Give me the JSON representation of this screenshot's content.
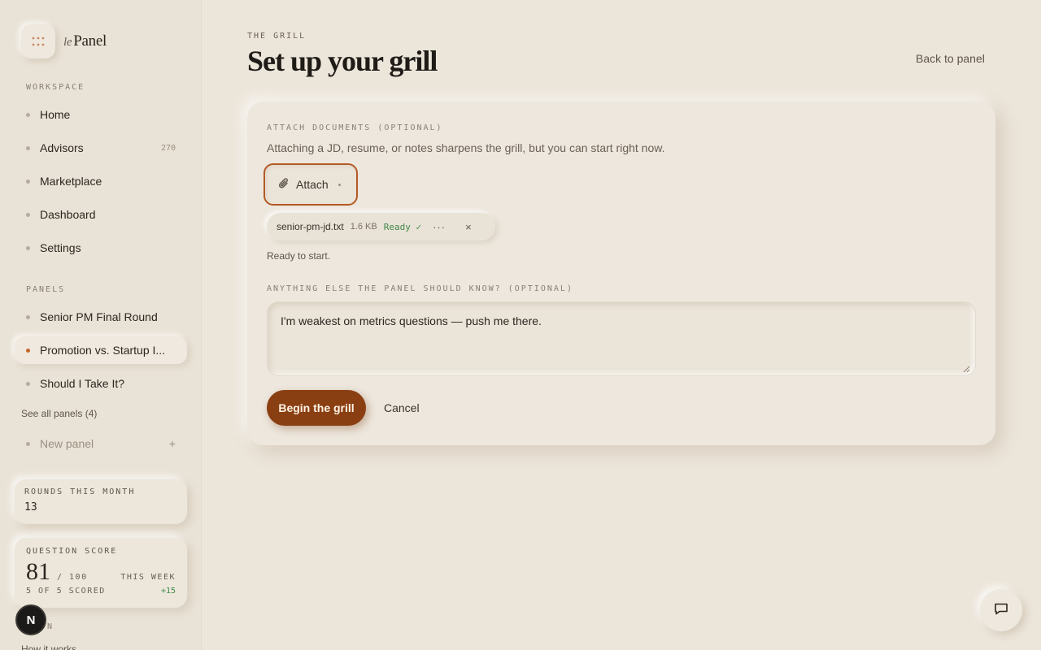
{
  "brand": {
    "prefix": "le",
    "name": "Panel",
    "icon": "grid-dots-icon"
  },
  "sidebar": {
    "workspace_label": "WORKSPACE",
    "workspace_items": [
      {
        "label": "Home"
      },
      {
        "label": "Advisors",
        "count": "270"
      },
      {
        "label": "Marketplace"
      },
      {
        "label": "Dashboard"
      },
      {
        "label": "Settings"
      }
    ],
    "panels_label": "PANELS",
    "panel_items": [
      {
        "label": "Senior PM Final Round"
      },
      {
        "label": "Promotion vs. Startup I...",
        "active": true
      },
      {
        "label": "Should I Take It?"
      }
    ],
    "see_all": "See all panels (4)",
    "new_panel": "New panel",
    "rounds": {
      "label": "ROUNDS THIS MONTH",
      "value": "13"
    },
    "score": {
      "label": "QUESTION SCORE",
      "value": "81",
      "of": "/ 100",
      "period": "THIS WEEK",
      "scored": "5 OF 5 SCORED",
      "delta": "+15"
    },
    "avatar_initial": "N",
    "below_label": "N",
    "how_it_works": "How it works"
  },
  "main": {
    "eyebrow": "THE GRILL",
    "title": "Set up your grill",
    "back_link": "Back to panel",
    "attach_label": "ATTACH DOCUMENTS (OPTIONAL)",
    "attach_hint": "Attaching a JD, resume, or notes sharpens the grill, but you can start right now.",
    "attach_button": "Attach",
    "file": {
      "name": "senior-pm-jd.txt",
      "size": "1.6 KB",
      "status": "Ready ✓",
      "more": "···",
      "close": "×"
    },
    "status_text": "Ready to start.",
    "notes_label": "ANYTHING ELSE THE PANEL SHOULD KNOW? (OPTIONAL)",
    "notes_value": "I'm weakest on metrics questions — push me there.",
    "begin_button": "Begin the grill",
    "cancel_button": "Cancel"
  },
  "colors": {
    "accent": "#8a3f12",
    "accent_border": "#b35a25",
    "success": "#3f8a4a",
    "background": "#ece5da"
  }
}
